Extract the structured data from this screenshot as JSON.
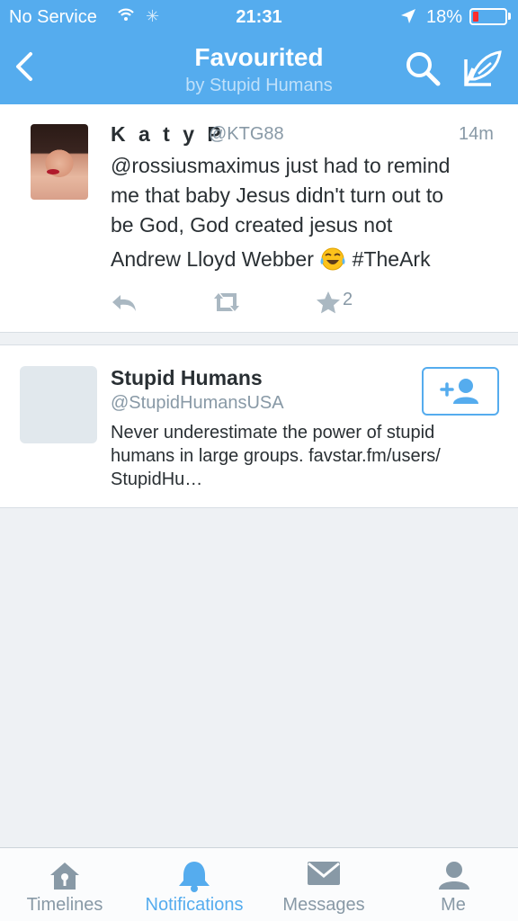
{
  "status_bar": {
    "carrier": "No Service",
    "time": "21:31",
    "battery_percent": "18%",
    "battery_level": 0.18,
    "spinner_glyph": "✳"
  },
  "header": {
    "title": "Favourited",
    "subtitle": "by Stupid Humans",
    "background_color": "#55acee"
  },
  "tweet": {
    "name": "K a t y P",
    "handle": "@KTG88",
    "time": "14m",
    "text_lines": [
      "@rossiusmaximus just had to remind",
      "me that baby Jesus didn't turn out to",
      "be God, God created jesus not"
    ],
    "last_line_before_emoji": "Andrew Lloyd Webber",
    "last_line_after_emoji": "#TheArk",
    "emoji": "face-with-tears-of-joy",
    "favorite_count": "2"
  },
  "user_card": {
    "name": "Stupid Humans",
    "handle": "@StupidHumansUSA",
    "bio_lines": [
      "Never underestimate the power of stupid",
      "humans in large groups. favstar.fm/users/",
      "StupidHu…"
    ]
  },
  "tabs": [
    {
      "label": "Timelines",
      "icon": "home-icon",
      "active": false
    },
    {
      "label": "Notifications",
      "icon": "bell-icon",
      "active": true
    },
    {
      "label": "Messages",
      "icon": "envelope-icon",
      "active": false
    },
    {
      "label": "Me",
      "icon": "person-icon",
      "active": false
    }
  ],
  "colors": {
    "accent": "#55acee",
    "muted": "#8899a6",
    "text": "#292f33",
    "battery_low": "#ff2d2d"
  }
}
